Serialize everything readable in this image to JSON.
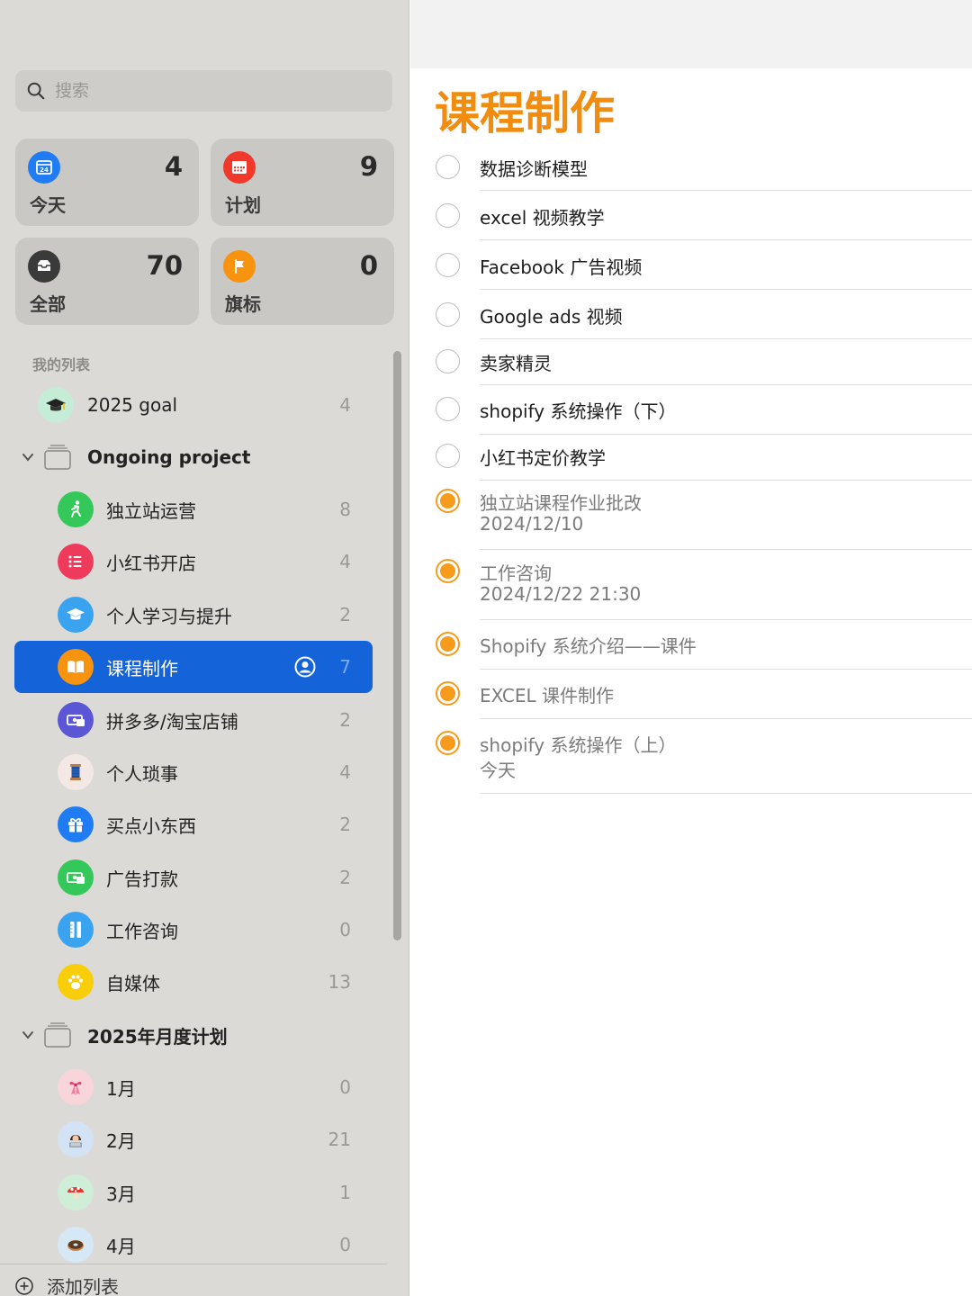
{
  "sidebar": {
    "search": {
      "placeholder": "搜索"
    },
    "smart_lists": [
      {
        "label": "今天",
        "count": "4",
        "icon": "calendar-icon",
        "color": "#1f7cf2"
      },
      {
        "label": "计划",
        "count": "9",
        "icon": "calendar-grid-icon",
        "color": "#f0382b"
      },
      {
        "label": "全部",
        "count": "70",
        "icon": "tray-icon",
        "color": "#3a3a3a"
      },
      {
        "label": "旗标",
        "count": "0",
        "icon": "flag-icon",
        "color": "#f7930f"
      }
    ],
    "section_title": "我的列表",
    "items": [
      {
        "label": "2025 goal",
        "count": "4",
        "icon": "graduation-cap-icon"
      },
      {
        "label": "Ongoing project",
        "icon": "folder-icon"
      },
      {
        "label": "独立站运营",
        "count": "8",
        "icon": "runner-icon",
        "color": "#34c759"
      },
      {
        "label": "小红书开店",
        "count": "4",
        "icon": "list-icon",
        "color": "#ee3b5b"
      },
      {
        "label": "个人学习与提升",
        "count": "2",
        "icon": "graduation-cap-icon",
        "color": "#3aa3f0"
      },
      {
        "label": "课程制作",
        "count": "7",
        "icon": "book-icon",
        "color": "#f7930f"
      },
      {
        "label": "拼多多/淘宝店铺",
        "count": "2",
        "icon": "money-icon",
        "color": "#5b56d6"
      },
      {
        "label": "个人琐事",
        "count": "4",
        "icon": "thread-spool-icon"
      },
      {
        "label": "买点小东西",
        "count": "2",
        "icon": "gift-icon",
        "color": "#1f7cf2"
      },
      {
        "label": "广告打款",
        "count": "2",
        "icon": "money-icon",
        "color": "#34c759"
      },
      {
        "label": "工作咨询",
        "count": "0",
        "icon": "ruler-icon",
        "color": "#3aa3f0"
      },
      {
        "label": "自媒体",
        "count": "13",
        "icon": "paw-icon",
        "color": "#f8cd0a"
      },
      {
        "label": "2025年月度计划",
        "icon": "folder-icon"
      },
      {
        "label": "1月",
        "count": "0",
        "icon": "ribbon-icon"
      },
      {
        "label": "2月",
        "count": "21",
        "icon": "person-laptop-icon"
      },
      {
        "label": "3月",
        "count": "1",
        "icon": "mushroom-icon"
      },
      {
        "label": "4月",
        "count": "0",
        "icon": "donut-icon"
      }
    ],
    "add_list": "添加列表"
  },
  "main": {
    "title": "课程制作",
    "accent_color": "#f28c0f",
    "tasks": [
      {
        "title": "数据诊断模型",
        "completed": false
      },
      {
        "title": "excel 视频教学",
        "completed": false
      },
      {
        "title": "Facebook 广告视频",
        "completed": false
      },
      {
        "title": "Google ads 视频",
        "completed": false
      },
      {
        "title": "卖家精灵",
        "completed": false
      },
      {
        "title": "shopify 系统操作（下）",
        "completed": false
      },
      {
        "title": "小红书定价教学",
        "completed": false
      },
      {
        "title": "独立站课程作业批改",
        "subtitle": "2024/12/10",
        "completed": true
      },
      {
        "title": "工作咨询",
        "subtitle": "2024/12/22 21:30",
        "completed": true
      },
      {
        "title": "Shopify 系统介绍——课件",
        "completed": true
      },
      {
        "title": "EXCEL 课件制作",
        "completed": true
      },
      {
        "title": "shopify 系统操作（上）",
        "subtitle": "今天",
        "completed": true
      }
    ]
  }
}
